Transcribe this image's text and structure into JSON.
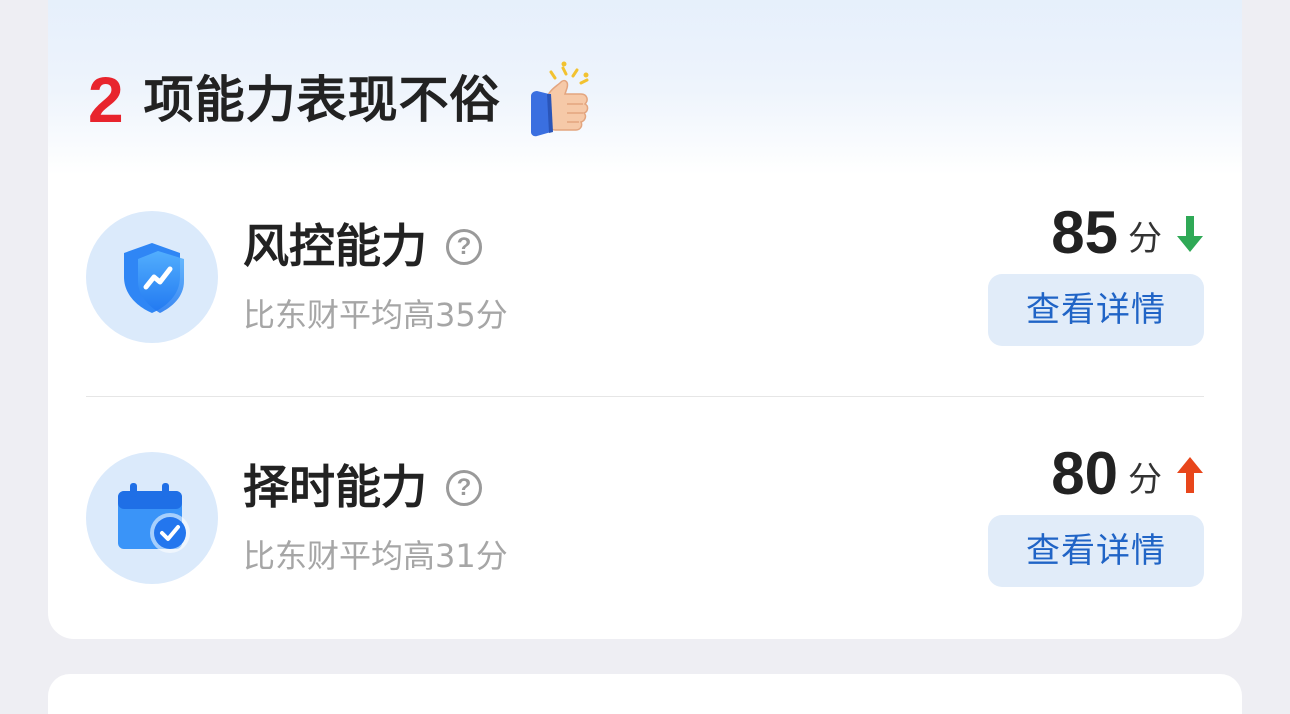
{
  "header": {
    "count": "2",
    "title": "项能力表现不俗",
    "icon": "thumbs-up-icon"
  },
  "abilities": [
    {
      "name": "风控能力",
      "icon": "shield-chart-icon",
      "help_icon": "question-icon",
      "subtitle": "比东财平均高35分",
      "score": "85",
      "unit": "分",
      "trend": "down",
      "trend_color": "#2fa956",
      "button_label": "查看详情"
    },
    {
      "name": "择时能力",
      "icon": "calendar-check-icon",
      "help_icon": "question-icon",
      "subtitle": "比东财平均高31分",
      "score": "80",
      "unit": "分",
      "trend": "up",
      "trend_color": "#e8461b",
      "button_label": "查看详情"
    }
  ],
  "colors": {
    "accent_red": "#e8242d",
    "button_text": "#2064c6",
    "button_bg": "#e1ecf9",
    "icon_circle_bg": "#dbeafb"
  }
}
